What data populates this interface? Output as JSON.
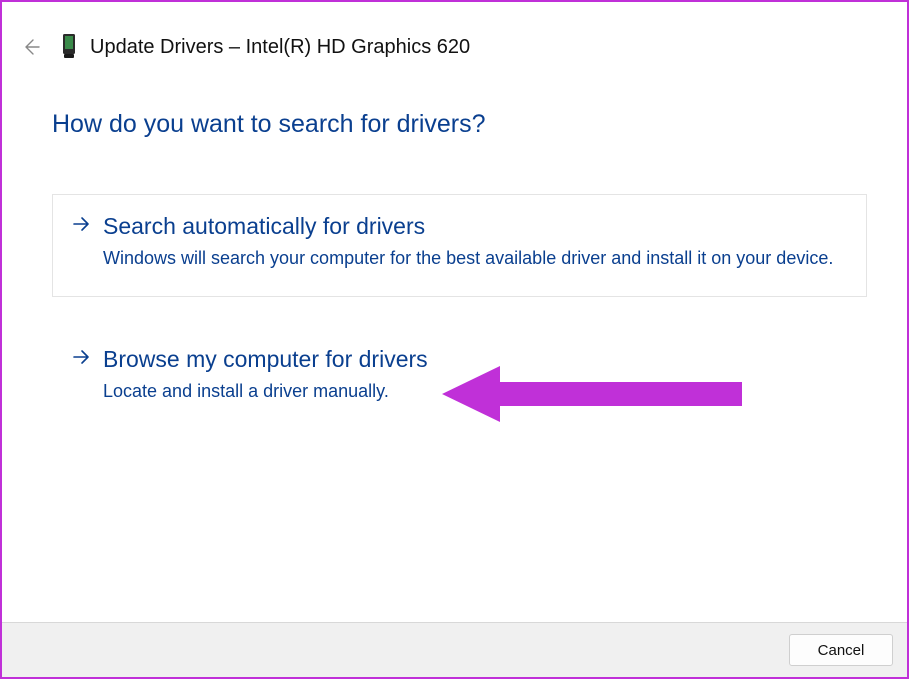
{
  "header": {
    "title": "Update Drivers – Intel(R) HD Graphics 620"
  },
  "main": {
    "question": "How do you want to search for drivers?"
  },
  "options": [
    {
      "title": "Search automatically for drivers",
      "description": "Windows will search your computer for the best available driver and install it on your device."
    },
    {
      "title": "Browse my computer for drivers",
      "description": "Locate and install a driver manually."
    }
  ],
  "footer": {
    "cancel": "Cancel"
  },
  "colors": {
    "accent": "#0a3f8f",
    "annotation": "#c030d8"
  }
}
